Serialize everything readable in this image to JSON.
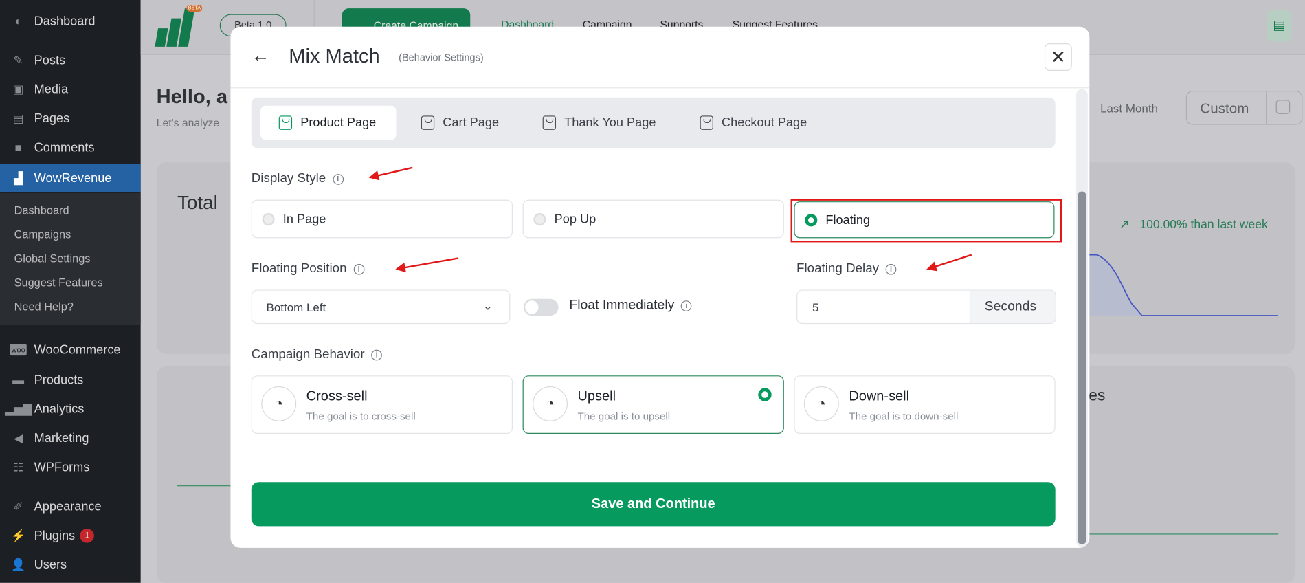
{
  "sidebar": {
    "items": [
      {
        "label": "Dashboard",
        "icon": "dashboard-icon"
      },
      {
        "label": "Posts",
        "icon": "pin-icon"
      },
      {
        "label": "Media",
        "icon": "media-icon"
      },
      {
        "label": "Pages",
        "icon": "pages-icon"
      },
      {
        "label": "Comments",
        "icon": "comment-icon"
      },
      {
        "label": "WowRevenue",
        "icon": "wowrevenue-icon"
      },
      {
        "label": "WooCommerce",
        "icon": "woo-icon"
      },
      {
        "label": "Products",
        "icon": "box-icon"
      },
      {
        "label": "Analytics",
        "icon": "bar-chart-icon"
      },
      {
        "label": "Marketing",
        "icon": "megaphone-icon"
      },
      {
        "label": "WPForms",
        "icon": "form-icon"
      },
      {
        "label": "Appearance",
        "icon": "brush-icon"
      },
      {
        "label": "Plugins",
        "icon": "plug-icon",
        "badge": "1"
      },
      {
        "label": "Users",
        "icon": "user-icon"
      }
    ],
    "submenu": [
      "Dashboard",
      "Campaigns",
      "Global Settings",
      "Suggest Features",
      "Need Help?"
    ]
  },
  "topbar": {
    "version": "Beta 1.0",
    "logo_badge": "BETA",
    "create_label": "Create Campaign",
    "nav": [
      "Dashboard",
      "Campaign",
      "Supports",
      "Suggest Features"
    ]
  },
  "page": {
    "greeting": "Hello, a",
    "subtitle": "Let's analyze",
    "last_month": "Last Month",
    "custom": "Custom",
    "card_title": "Total",
    "trend": "100.00% than last week",
    "card2_title_fragment": "es"
  },
  "modal": {
    "title": "Mix Match",
    "subtitle": "(Behavior Settings)",
    "tabs": [
      "Product Page",
      "Cart Page",
      "Thank You Page",
      "Checkout Page"
    ],
    "active_tab": "Product Page",
    "display_style": {
      "label": "Display Style",
      "options": [
        "In Page",
        "Pop Up",
        "Floating"
      ],
      "selected": "Floating"
    },
    "floating_position": {
      "label": "Floating Position",
      "value": "Bottom Left"
    },
    "float_immediately": {
      "label": "Float Immediately",
      "on": false
    },
    "floating_delay": {
      "label": "Floating Delay",
      "value": "5",
      "unit": "Seconds"
    },
    "campaign_behavior": {
      "label": "Campaign Behavior",
      "selected": "Upsell",
      "options": [
        {
          "title": "Cross-sell",
          "desc": "The goal is to cross-sell"
        },
        {
          "title": "Upsell",
          "desc": "The goal is to upsell"
        },
        {
          "title": "Down-sell",
          "desc": "The goal is to down-sell"
        }
      ]
    },
    "save_label": "Save and Continue"
  },
  "colors": {
    "accent": "#069a5e",
    "annotation": "#e01818",
    "sidebar_active": "#2462a3"
  }
}
